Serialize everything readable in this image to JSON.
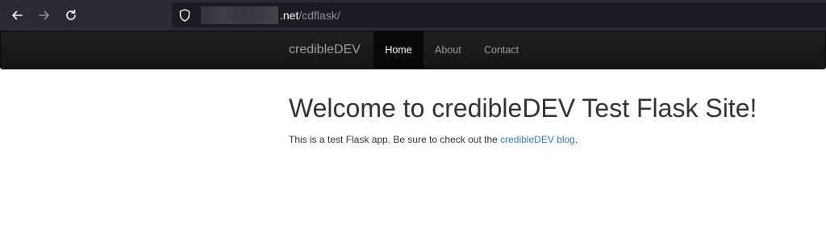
{
  "browser": {
    "url_host_suffix": ".net",
    "url_path": "/cdflask/"
  },
  "navbar": {
    "brand": "credibleDEV",
    "items": [
      {
        "label": "Home"
      },
      {
        "label": "About"
      },
      {
        "label": "Contact"
      }
    ],
    "active_item": "Home"
  },
  "main": {
    "title": "Welcome to credibleDEV Test Flask Site!",
    "intro_text": "This is a test Flask app. Be sure to check out the ",
    "intro_link": "credibleDEV blog",
    "intro_end": "."
  },
  "colors": {
    "navbar_bg": "#1b1b1b",
    "link": "#337ab7",
    "text": "#333333"
  }
}
